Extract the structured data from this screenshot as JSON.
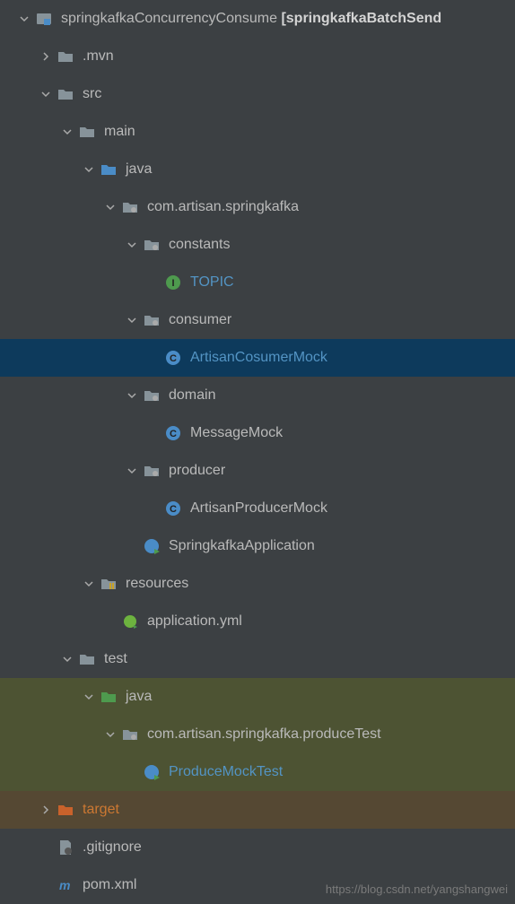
{
  "tree": {
    "root": {
      "name": "springkafkaConcurrencyConsume",
      "suffix": "[springkafkaBatchSend"
    },
    "mvn": ".mvn",
    "src": "src",
    "main": "main",
    "java": "java",
    "package": "com.artisan.springkafka",
    "constants": "constants",
    "topic": "TOPIC",
    "consumer": "consumer",
    "artisanConsumerMock": "ArtisanCosumerMock",
    "domain": "domain",
    "messageMock": "MessageMock",
    "producer": "producer",
    "artisanProducerMock": "ArtisanProducerMock",
    "springkafkaApplication": "SpringkafkaApplication",
    "resources": "resources",
    "applicationYml": "application.yml",
    "test": "test",
    "testJava": "java",
    "testPackage": "com.artisan.springkafka.produceTest",
    "produceMockTest": "ProduceMockTest",
    "target": "target",
    "gitignore": ".gitignore",
    "pomXml": "pom.xml"
  },
  "watermark": "https://blog.csdn.net/yangshangwei"
}
